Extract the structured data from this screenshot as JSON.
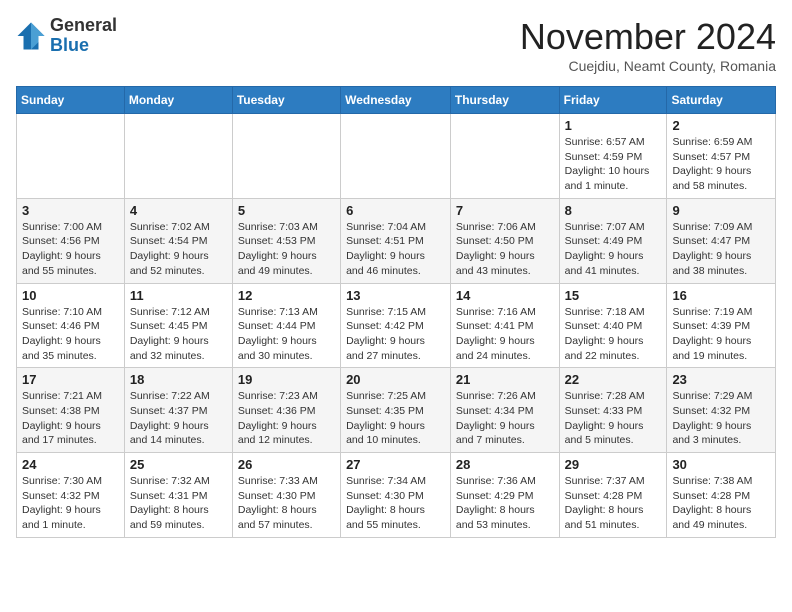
{
  "header": {
    "logo_line1": "General",
    "logo_line2": "Blue",
    "month": "November 2024",
    "location": "Cuejdiu, Neamt County, Romania"
  },
  "weekdays": [
    "Sunday",
    "Monday",
    "Tuesday",
    "Wednesday",
    "Thursday",
    "Friday",
    "Saturday"
  ],
  "weeks": [
    [
      {
        "day": "",
        "detail": ""
      },
      {
        "day": "",
        "detail": ""
      },
      {
        "day": "",
        "detail": ""
      },
      {
        "day": "",
        "detail": ""
      },
      {
        "day": "",
        "detail": ""
      },
      {
        "day": "1",
        "detail": "Sunrise: 6:57 AM\nSunset: 4:59 PM\nDaylight: 10 hours and 1 minute."
      },
      {
        "day": "2",
        "detail": "Sunrise: 6:59 AM\nSunset: 4:57 PM\nDaylight: 9 hours and 58 minutes."
      }
    ],
    [
      {
        "day": "3",
        "detail": "Sunrise: 7:00 AM\nSunset: 4:56 PM\nDaylight: 9 hours and 55 minutes."
      },
      {
        "day": "4",
        "detail": "Sunrise: 7:02 AM\nSunset: 4:54 PM\nDaylight: 9 hours and 52 minutes."
      },
      {
        "day": "5",
        "detail": "Sunrise: 7:03 AM\nSunset: 4:53 PM\nDaylight: 9 hours and 49 minutes."
      },
      {
        "day": "6",
        "detail": "Sunrise: 7:04 AM\nSunset: 4:51 PM\nDaylight: 9 hours and 46 minutes."
      },
      {
        "day": "7",
        "detail": "Sunrise: 7:06 AM\nSunset: 4:50 PM\nDaylight: 9 hours and 43 minutes."
      },
      {
        "day": "8",
        "detail": "Sunrise: 7:07 AM\nSunset: 4:49 PM\nDaylight: 9 hours and 41 minutes."
      },
      {
        "day": "9",
        "detail": "Sunrise: 7:09 AM\nSunset: 4:47 PM\nDaylight: 9 hours and 38 minutes."
      }
    ],
    [
      {
        "day": "10",
        "detail": "Sunrise: 7:10 AM\nSunset: 4:46 PM\nDaylight: 9 hours and 35 minutes."
      },
      {
        "day": "11",
        "detail": "Sunrise: 7:12 AM\nSunset: 4:45 PM\nDaylight: 9 hours and 32 minutes."
      },
      {
        "day": "12",
        "detail": "Sunrise: 7:13 AM\nSunset: 4:44 PM\nDaylight: 9 hours and 30 minutes."
      },
      {
        "day": "13",
        "detail": "Sunrise: 7:15 AM\nSunset: 4:42 PM\nDaylight: 9 hours and 27 minutes."
      },
      {
        "day": "14",
        "detail": "Sunrise: 7:16 AM\nSunset: 4:41 PM\nDaylight: 9 hours and 24 minutes."
      },
      {
        "day": "15",
        "detail": "Sunrise: 7:18 AM\nSunset: 4:40 PM\nDaylight: 9 hours and 22 minutes."
      },
      {
        "day": "16",
        "detail": "Sunrise: 7:19 AM\nSunset: 4:39 PM\nDaylight: 9 hours and 19 minutes."
      }
    ],
    [
      {
        "day": "17",
        "detail": "Sunrise: 7:21 AM\nSunset: 4:38 PM\nDaylight: 9 hours and 17 minutes."
      },
      {
        "day": "18",
        "detail": "Sunrise: 7:22 AM\nSunset: 4:37 PM\nDaylight: 9 hours and 14 minutes."
      },
      {
        "day": "19",
        "detail": "Sunrise: 7:23 AM\nSunset: 4:36 PM\nDaylight: 9 hours and 12 minutes."
      },
      {
        "day": "20",
        "detail": "Sunrise: 7:25 AM\nSunset: 4:35 PM\nDaylight: 9 hours and 10 minutes."
      },
      {
        "day": "21",
        "detail": "Sunrise: 7:26 AM\nSunset: 4:34 PM\nDaylight: 9 hours and 7 minutes."
      },
      {
        "day": "22",
        "detail": "Sunrise: 7:28 AM\nSunset: 4:33 PM\nDaylight: 9 hours and 5 minutes."
      },
      {
        "day": "23",
        "detail": "Sunrise: 7:29 AM\nSunset: 4:32 PM\nDaylight: 9 hours and 3 minutes."
      }
    ],
    [
      {
        "day": "24",
        "detail": "Sunrise: 7:30 AM\nSunset: 4:32 PM\nDaylight: 9 hours and 1 minute."
      },
      {
        "day": "25",
        "detail": "Sunrise: 7:32 AM\nSunset: 4:31 PM\nDaylight: 8 hours and 59 minutes."
      },
      {
        "day": "26",
        "detail": "Sunrise: 7:33 AM\nSunset: 4:30 PM\nDaylight: 8 hours and 57 minutes."
      },
      {
        "day": "27",
        "detail": "Sunrise: 7:34 AM\nSunset: 4:30 PM\nDaylight: 8 hours and 55 minutes."
      },
      {
        "day": "28",
        "detail": "Sunrise: 7:36 AM\nSunset: 4:29 PM\nDaylight: 8 hours and 53 minutes."
      },
      {
        "day": "29",
        "detail": "Sunrise: 7:37 AM\nSunset: 4:28 PM\nDaylight: 8 hours and 51 minutes."
      },
      {
        "day": "30",
        "detail": "Sunrise: 7:38 AM\nSunset: 4:28 PM\nDaylight: 8 hours and 49 minutes."
      }
    ]
  ]
}
